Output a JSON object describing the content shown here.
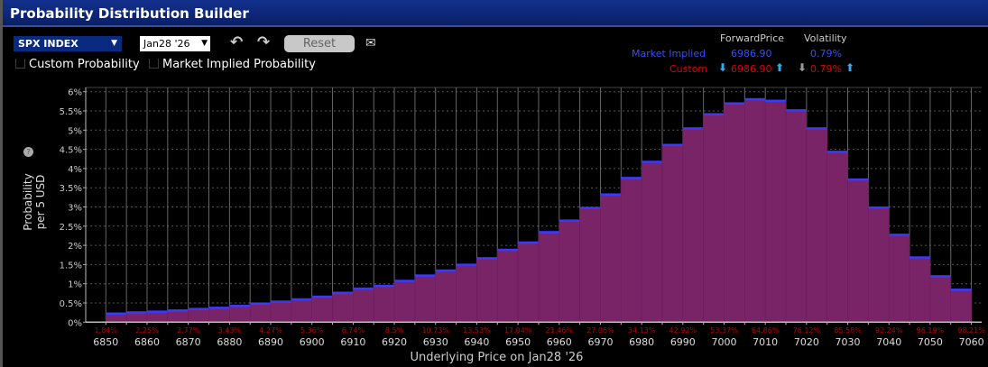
{
  "window": {
    "title": "Probability Distribution Builder"
  },
  "toolbar": {
    "symbol": "SPX INDEX",
    "expiry": "Jan28 '26",
    "undo_icon": "undo-icon",
    "redo_icon": "redo-icon",
    "reset_label": "Reset",
    "email_icon": "envelope-icon"
  },
  "legend": {
    "custom": "Custom Probability",
    "market": "Market Implied Probability",
    "custom_color": "#cc0000",
    "market_color": "#2020ff"
  },
  "summary": {
    "col_forward": "ForwardPrice",
    "col_vol": "Volatility",
    "market_label": "Market Implied",
    "market_forward": "6986.90",
    "market_vol": "0.79%",
    "custom_label": "Custom",
    "custom_forward": "6986.90",
    "custom_vol": "0.79%"
  },
  "chart_data": {
    "type": "bar",
    "ylabel_line1": "Probability",
    "ylabel_line2": "per 5 USD",
    "xlabel": "Underlying Price on Jan28 '26",
    "ylim": [
      0,
      6
    ],
    "yticks": [
      "0%",
      "0.5%",
      "1%",
      "1.5%",
      "2%",
      "2.5%",
      "3%",
      "3.5%",
      "4%",
      "4.5%",
      "5%",
      "5.5%",
      "6%"
    ],
    "bin_width": 5,
    "x_start": 6850,
    "values": [
      0.23,
      0.26,
      0.28,
      0.31,
      0.35,
      0.38,
      0.43,
      0.49,
      0.54,
      0.6,
      0.67,
      0.77,
      0.88,
      0.95,
      1.08,
      1.22,
      1.35,
      1.5,
      1.67,
      1.89,
      2.08,
      2.35,
      2.65,
      2.98,
      3.33,
      3.76,
      4.18,
      4.62,
      5.05,
      5.42,
      5.7,
      5.81,
      5.77,
      5.52,
      5.05,
      4.44,
      3.72,
      2.99,
      2.28,
      1.69,
      1.2,
      0.85
    ],
    "xticks": [
      "6850",
      "6860",
      "6870",
      "6880",
      "6890",
      "6900",
      "6910",
      "6920",
      "6930",
      "6940",
      "6950",
      "6960",
      "6970",
      "6980",
      "6990",
      "7000",
      "7010",
      "7020",
      "7030",
      "7040",
      "7050",
      "7060"
    ],
    "cumulative_labels": [
      "1.84%",
      "2.25%",
      "2.77%",
      "3.43%",
      "4.27%",
      "5.36%",
      "6.74%",
      "8.5%",
      "10.73%",
      "13.53%",
      "17.04%",
      "21.46%",
      "27.06%",
      "34.13%",
      "42.92%",
      "53.37%",
      "64.86%",
      "76.12%",
      "85.58%",
      "92.24%",
      "96.19%",
      "98.21%"
    ],
    "bar_color": "#7a2468",
    "bar_top_color": "#3a3aff",
    "grid": true
  }
}
